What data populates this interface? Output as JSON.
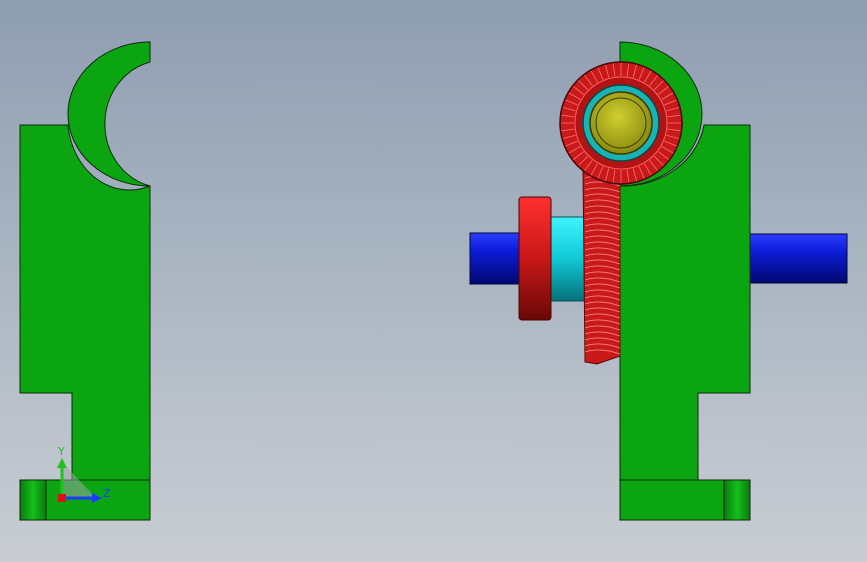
{
  "viewport": {
    "background_top": "#8e9db0",
    "background_bottom": "#c9cdd3"
  },
  "colors": {
    "bracket": "#0ca512",
    "outline": "#0b2a0b",
    "shaft": "#0a14b0",
    "collar_red": "#d0191c",
    "spacer_cyan": "#16d8e4",
    "gear_red": "#c81a1a",
    "bearing_teal": "#19b3b3",
    "hub_yellow": "#b3b31a"
  },
  "triad": {
    "y_label": "Y",
    "z_label": "Z",
    "y_color": "#20c020",
    "z_color": "#1a3cff",
    "x_color": "#e01010"
  }
}
